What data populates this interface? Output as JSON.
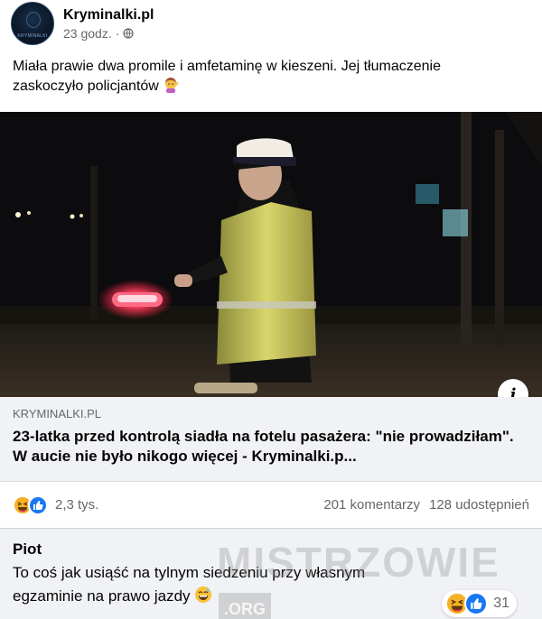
{
  "post": {
    "page_name": "Kryminalki.pl",
    "avatar_text": "KRYMINALKI",
    "time": "23 godz.",
    "separator": "·",
    "text_line1": "Miała prawie dwa promile i amfetaminę w kieszeni. Jej tłumaczenie",
    "text_line2": "zaskoczyło policjantów"
  },
  "link": {
    "domain": "KRYMINALKI.PL",
    "title": "23-latka przed kontrolą siadła na fotelu pasażera: \"nie prowadziłam\". W aucie nie było nikogo więcej - Kryminalki.p...",
    "info_glyph": "i"
  },
  "stats": {
    "reactions_count": "2,3 tys.",
    "comments": "201 komentarzy",
    "shares": "128 udostępnień"
  },
  "comment": {
    "author": "Piot",
    "text": "To coś jak usiąść na tylnym siedzeniu przy własnym egzaminie na prawo jazdy",
    "reactions_count": "31"
  },
  "watermark": {
    "text": "MISTRZOWIE",
    "suffix": ".ORG"
  },
  "colors": {
    "like_blue": "#1877f2",
    "haha_yellow": "#f7b125",
    "secondary_text": "#65676b",
    "link_background": "#f0f2f5"
  },
  "icons": [
    "avatar-logo",
    "globe-icon",
    "person-gesturing-emoji",
    "haha-reaction-icon",
    "like-reaction-icon",
    "info-icon",
    "grinning-sweat-emoji"
  ]
}
